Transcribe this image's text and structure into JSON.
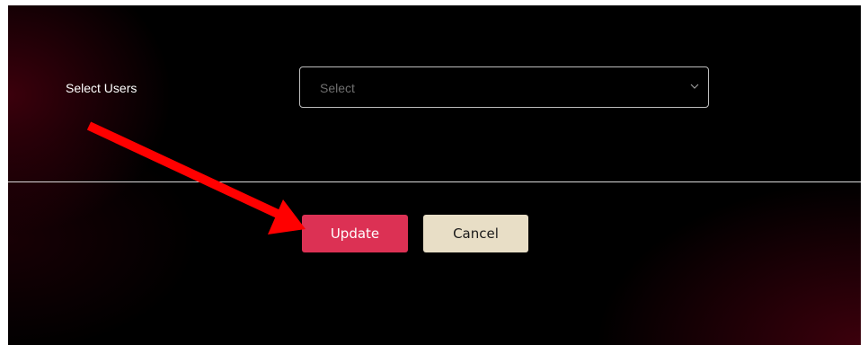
{
  "form": {
    "select_users_label": "Select Users",
    "select_placeholder": "Select"
  },
  "actions": {
    "update_label": "Update",
    "cancel_label": "Cancel"
  },
  "colors": {
    "update_button": "#dc3154",
    "cancel_button": "#e8dec6",
    "annotation_arrow": "#ff0000"
  },
  "icons": {
    "select_chevron": "chevron-down-icon",
    "annotation": "red-arrow-annotation"
  }
}
